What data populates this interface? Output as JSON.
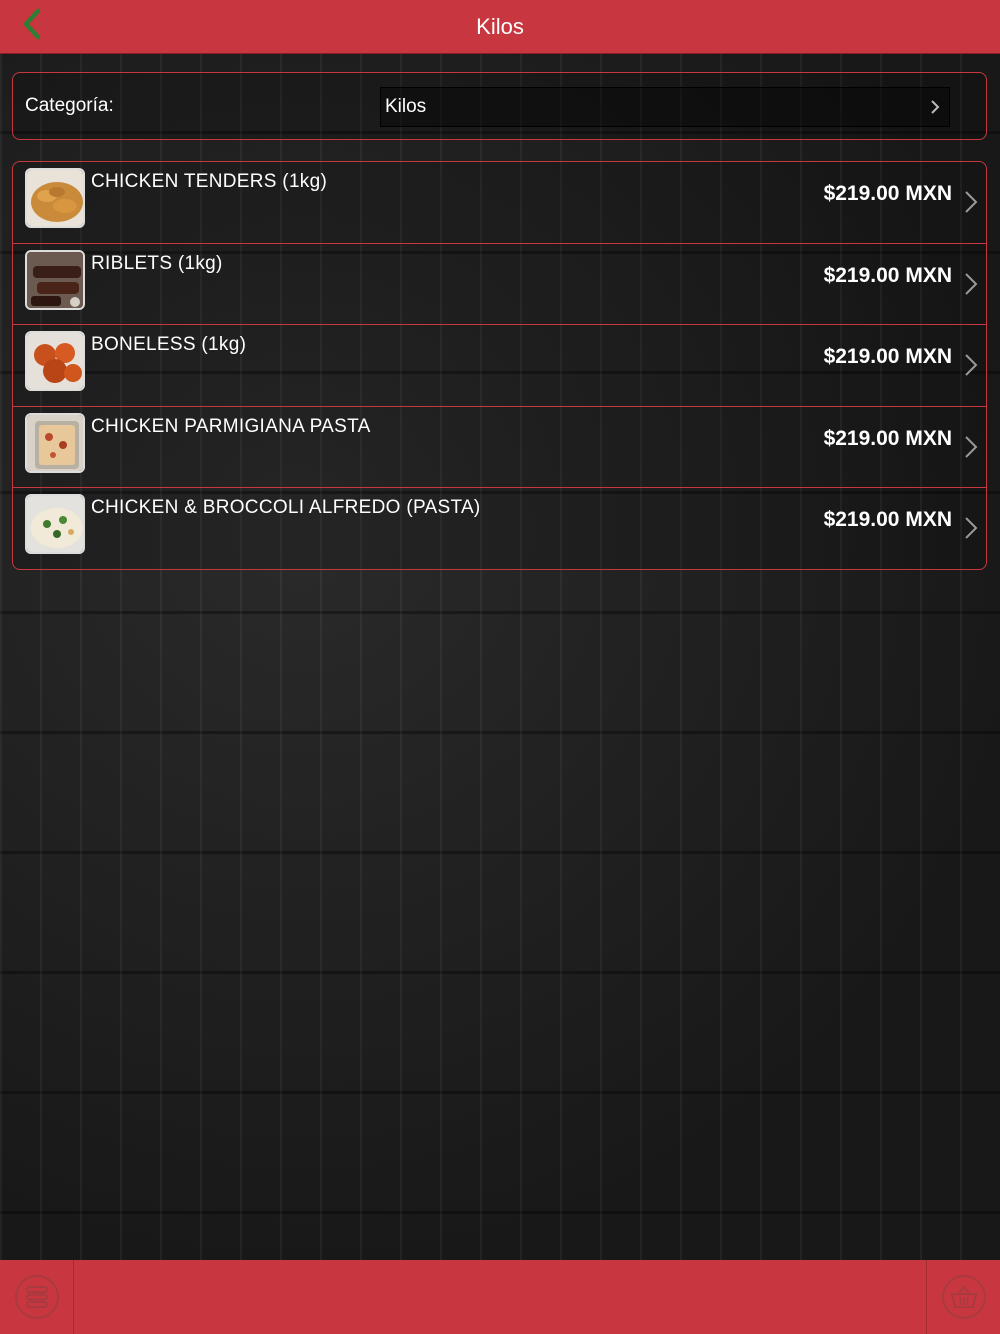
{
  "header": {
    "title": "Kilos",
    "back_icon": "chevron-left-icon"
  },
  "category": {
    "label": "Categoría:",
    "value": "Kilos"
  },
  "products": [
    {
      "name": "CHICKEN TENDERS (1kg)",
      "price": "$219.00 MXN",
      "image": "chicken-tenders-photo"
    },
    {
      "name": "RIBLETS (1kg)",
      "price": "$219.00 MXN",
      "image": "riblets-photo"
    },
    {
      "name": "BONELESS (1kg)",
      "price": "$219.00 MXN",
      "image": "boneless-photo"
    },
    {
      "name": "CHICKEN PARMIGIANA PASTA",
      "price": "$219.00 MXN",
      "image": "parmigiana-pasta-photo"
    },
    {
      "name": "CHICKEN & BROCCOLI ALFREDO (PASTA)",
      "price": "$219.00 MXN",
      "image": "alfredo-pasta-photo"
    }
  ],
  "footer": {
    "left_icon": "menu-list-icon",
    "right_icon": "basket-icon"
  },
  "colors": {
    "accent": "#c8373f",
    "back_arrow": "#2e7d32"
  }
}
